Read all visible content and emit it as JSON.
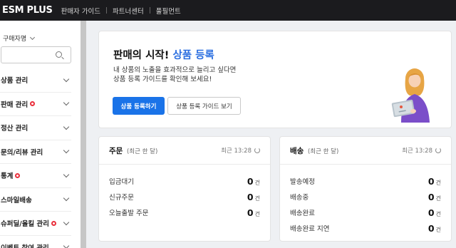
{
  "topbar": {
    "logo": "ESM PLUS",
    "nav": [
      "판매자 가이드",
      "파트너센터",
      "풀필먼트"
    ]
  },
  "sidebar": {
    "buyer_label": "구매자명",
    "search_placeholder": "",
    "items": [
      {
        "label": "상품 관리",
        "badge": false
      },
      {
        "label": "판매 관리",
        "badge": true
      },
      {
        "label": "정산 관리",
        "badge": false
      },
      {
        "label": "문의/리뷰 관리",
        "badge": false
      },
      {
        "label": "통계",
        "badge": true
      },
      {
        "label": "스마일배송",
        "badge": false
      },
      {
        "label": "슈퍼딜/올킬 관리",
        "badge": true
      },
      {
        "label": "이벤트 참여 관리",
        "badge": false
      }
    ]
  },
  "hero": {
    "title_prefix": "판매의 시작!",
    "title_accent": "상품 등록",
    "desc_line1": "내 상품의 노출을 효과적으로 늘리고 싶다면",
    "desc_line2": "상품 등록 가이드를 확인해 보세요!",
    "primary_button": "상품 등록하기",
    "secondary_button": "상품 등록 가이드 보기"
  },
  "order_card": {
    "title": "주문",
    "subtitle": "(최근 한 달)",
    "recent": "최근 13:28",
    "rows": [
      {
        "label": "입금대기",
        "value": "0",
        "unit": "건"
      },
      {
        "label": "신규주문",
        "value": "0",
        "unit": "건"
      },
      {
        "label": "오늘출발 주문",
        "value": "0",
        "unit": "건"
      }
    ]
  },
  "ship_card": {
    "title": "배송",
    "subtitle": "(최근 한 달)",
    "recent": "최근 13:28",
    "rows": [
      {
        "label": "발송예정",
        "value": "0",
        "unit": "건"
      },
      {
        "label": "배송중",
        "value": "0",
        "unit": "건"
      },
      {
        "label": "배송완료",
        "value": "0",
        "unit": "건"
      },
      {
        "label": "배송완료 지연",
        "value": "0",
        "unit": "건"
      }
    ]
  },
  "colors": {
    "accent": "#1a73e8",
    "topbar": "#1b1b1e",
    "badge": "#ea2f3c"
  }
}
